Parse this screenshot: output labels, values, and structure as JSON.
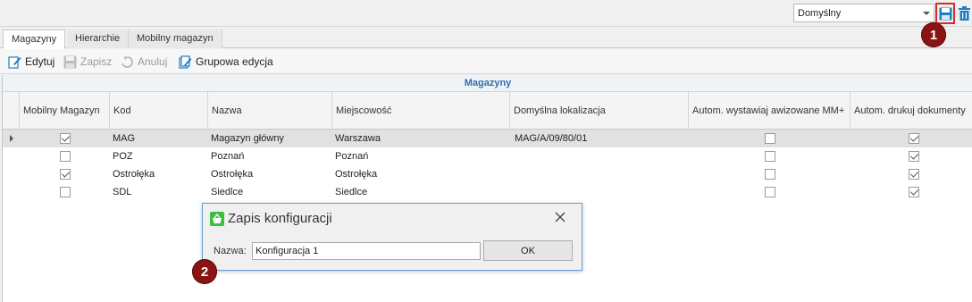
{
  "topbar": {
    "layout_select_value": "Domyślny",
    "save_icon": "floppy-disk-icon",
    "delete_icon": "trash-icon"
  },
  "badges": {
    "one": "1",
    "two": "2"
  },
  "tabs": [
    {
      "label": "Magazyny",
      "active": true
    },
    {
      "label": "Hierarchie",
      "active": false
    },
    {
      "label": "Mobilny magazyn",
      "active": false
    }
  ],
  "toolbar": {
    "edit_label": "Edytuj",
    "save_label": "Zapisz",
    "cancel_label": "Anuluj",
    "group_edit_label": "Grupowa edycja"
  },
  "grid": {
    "band_title": "Magazyny",
    "columns": [
      "Mobilny Magazyn",
      "Kod",
      "Nazwa",
      "Miejscowość",
      "Domyślna lokalizacja",
      "Autom. wystawiaj awizowane MM+",
      "Autom. drukuj dokumenty"
    ],
    "rows": [
      {
        "mobile": true,
        "code": "MAG",
        "name": "Magazyn główny",
        "city": "Warszawa",
        "location": "MAG/A/09/80/01",
        "auto_mm": false,
        "auto_print": true,
        "selected": true
      },
      {
        "mobile": false,
        "code": "POZ",
        "name": "Poznań",
        "city": "Poznań",
        "location": "",
        "auto_mm": false,
        "auto_print": true,
        "selected": false
      },
      {
        "mobile": true,
        "code": "Ostrołęka",
        "name": "Ostrołęka",
        "city": "Ostrołęka",
        "location": "",
        "auto_mm": false,
        "auto_print": true,
        "selected": false
      },
      {
        "mobile": false,
        "code": "SDL",
        "name": "Siedlce",
        "city": "Siedlce",
        "location": "",
        "auto_mm": false,
        "auto_print": true,
        "selected": false
      }
    ]
  },
  "dialog": {
    "title": "Zapis konfiguracji",
    "name_label": "Nazwa:",
    "name_value": "Konfiguracja 1",
    "ok_label": "OK"
  },
  "colors": {
    "badge": "#8a1414",
    "highlight_border": "#d52b2b",
    "band_text": "#2f6fa8",
    "dialog_border": "#6a9fd4"
  }
}
